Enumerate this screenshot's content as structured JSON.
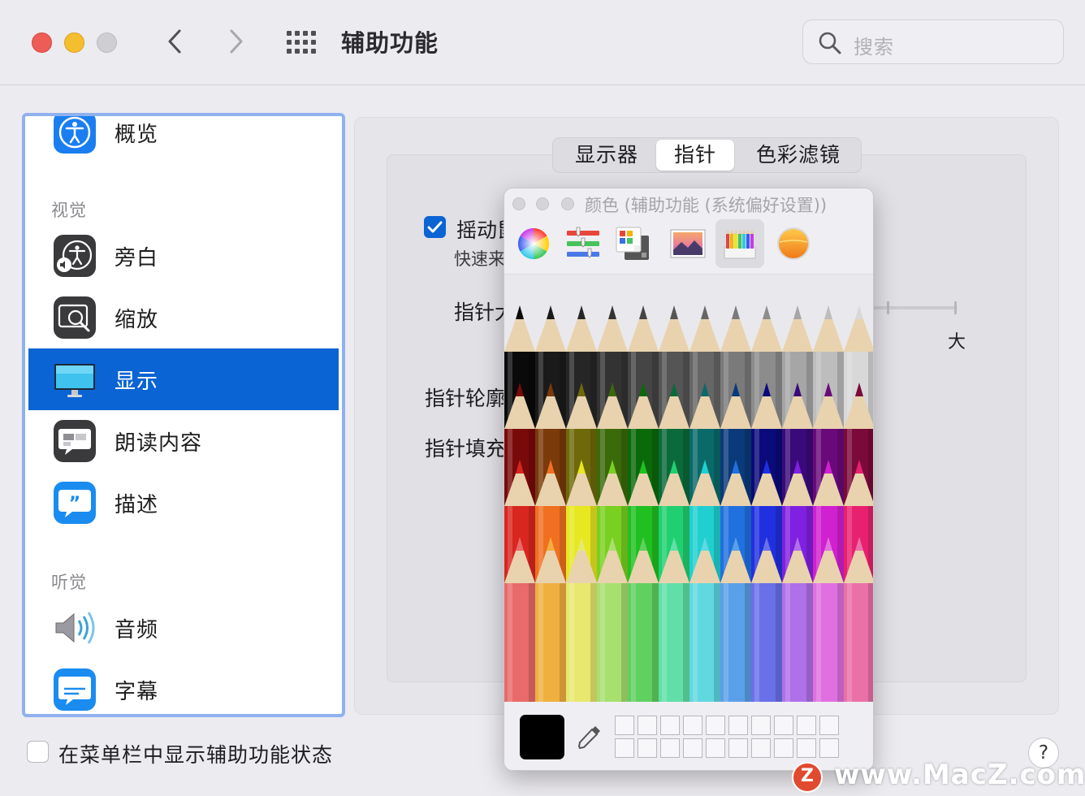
{
  "window": {
    "title": "辅助功能"
  },
  "search": {
    "placeholder": "搜索"
  },
  "sidebar": {
    "items": [
      {
        "id": "overview",
        "label": "概览",
        "icon": "accessibility-icon"
      },
      {
        "id": "voiceover",
        "label": "旁白",
        "icon": "voiceover-icon"
      },
      {
        "id": "zoom",
        "label": "缩放",
        "icon": "zoom-icon"
      },
      {
        "id": "display",
        "label": "显示",
        "icon": "display-monitor-icon",
        "selected": true
      },
      {
        "id": "spoken",
        "label": "朗读内容",
        "icon": "speech-bubble-icon"
      },
      {
        "id": "descriptions",
        "label": "描述",
        "icon": "quote-bubble-icon"
      },
      {
        "id": "audio",
        "label": "音频",
        "icon": "speaker-icon"
      },
      {
        "id": "captions",
        "label": "字幕",
        "icon": "captions-icon"
      }
    ],
    "sections": {
      "vision": "视觉",
      "hearing": "听觉"
    }
  },
  "tabs": [
    "显示器",
    "指针",
    "色彩滤镜"
  ],
  "tab_selected": "指针",
  "pointer": {
    "shake_label": "摇动鼠",
    "shake_checked": true,
    "shake_desc": "快速来",
    "size_label": "指针大",
    "size_max_label": "大",
    "outline_label": "指针轮廓",
    "fill_label": "指针填充"
  },
  "color_panel": {
    "title": "颜色 (辅助功能 (系统偏好设置))",
    "modes": [
      "color-wheel-icon",
      "color-sliders-icon",
      "color-palettes-icon",
      "image-palettes-icon",
      "pencils-icon",
      "sunset-orb-icon"
    ],
    "active_mode": "pencils-icon",
    "current_color": "#000000",
    "pencil_colors": [
      [
        "#0a0a0a",
        "#1a1a1a",
        "#262626",
        "#333333",
        "#454545",
        "#555555",
        "#666666",
        "#7a7a7a",
        "#8c8c8c",
        "#a6a6a6",
        "#bdbdbd",
        "#d8d8d8"
      ],
      [
        "#7a0a0a",
        "#7a3a0a",
        "#6e6a0a",
        "#3a6a0a",
        "#0a6a0a",
        "#0a6a3a",
        "#0a6a6a",
        "#0a3a7a",
        "#0a0a7a",
        "#3a0a7a",
        "#6a0a7a",
        "#7a0a3a"
      ],
      [
        "#d9261e",
        "#f07020",
        "#e8e820",
        "#7ad020",
        "#20c020",
        "#20d070",
        "#20d0d0",
        "#2070e0",
        "#2030e0",
        "#8020e0",
        "#d020d0",
        "#e82070"
      ],
      [
        "#e86a6a",
        "#f0b040",
        "#e8e870",
        "#a8e070",
        "#60d060",
        "#60e0a8",
        "#60d8e0",
        "#5aa0e8",
        "#6a70e8",
        "#b070e8",
        "#e070e0",
        "#ea70a8"
      ]
    ]
  },
  "bottom": {
    "menu_bar_label": "在菜单栏中显示辅助功能状态",
    "help": "?"
  },
  "watermark": {
    "letter": "Z",
    "text": "www.MacZ.com"
  }
}
